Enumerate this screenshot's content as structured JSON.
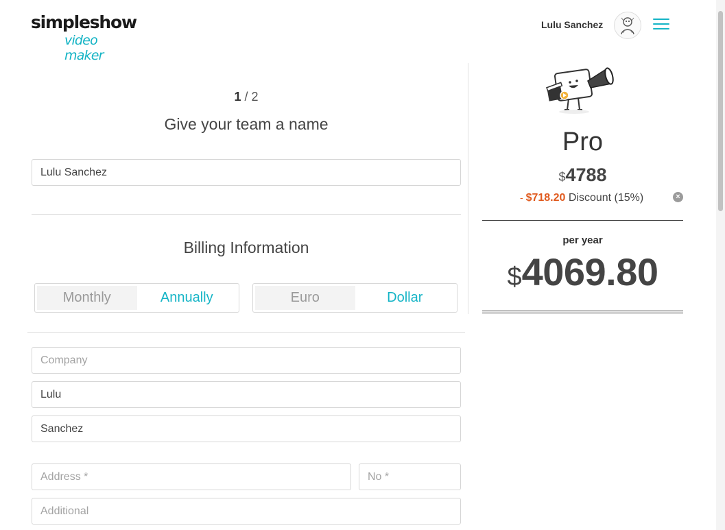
{
  "header": {
    "logo_top": "simpleshow",
    "logo_bottom": "video maker",
    "user_name": "Lulu Sanchez"
  },
  "steps": {
    "current": "1",
    "separator": " / ",
    "total": "2"
  },
  "team": {
    "title": "Give your team a name",
    "name_value": "Lulu Sanchez"
  },
  "billing": {
    "title": "Billing Information",
    "period_options": [
      "Monthly",
      "Annually"
    ],
    "period_selected": "Annually",
    "currency_options": [
      "Euro",
      "Dollar"
    ],
    "currency_selected": "Dollar",
    "company_placeholder": "Company",
    "first_name_value": "Lulu",
    "last_name_value": "Sanchez",
    "address_placeholder": "Address *",
    "number_placeholder": "No *",
    "additional_placeholder": "Additional"
  },
  "plan": {
    "name": "Pro",
    "currency_symbol": "$",
    "price": "4788",
    "discount_prefix": "- ",
    "discount_amount": "$718.20",
    "discount_label": "Discount (15%)",
    "per_year_label": "per year",
    "total": "4069.80"
  },
  "colors": {
    "accent": "#14b4c6",
    "discount": "#e05a1e",
    "text": "#444444"
  },
  "icons": {
    "menu": "hamburger-icon",
    "remove_discount": "close-circle-icon",
    "avatar": "user-avatar",
    "mascot": "megaphone-mascot"
  }
}
